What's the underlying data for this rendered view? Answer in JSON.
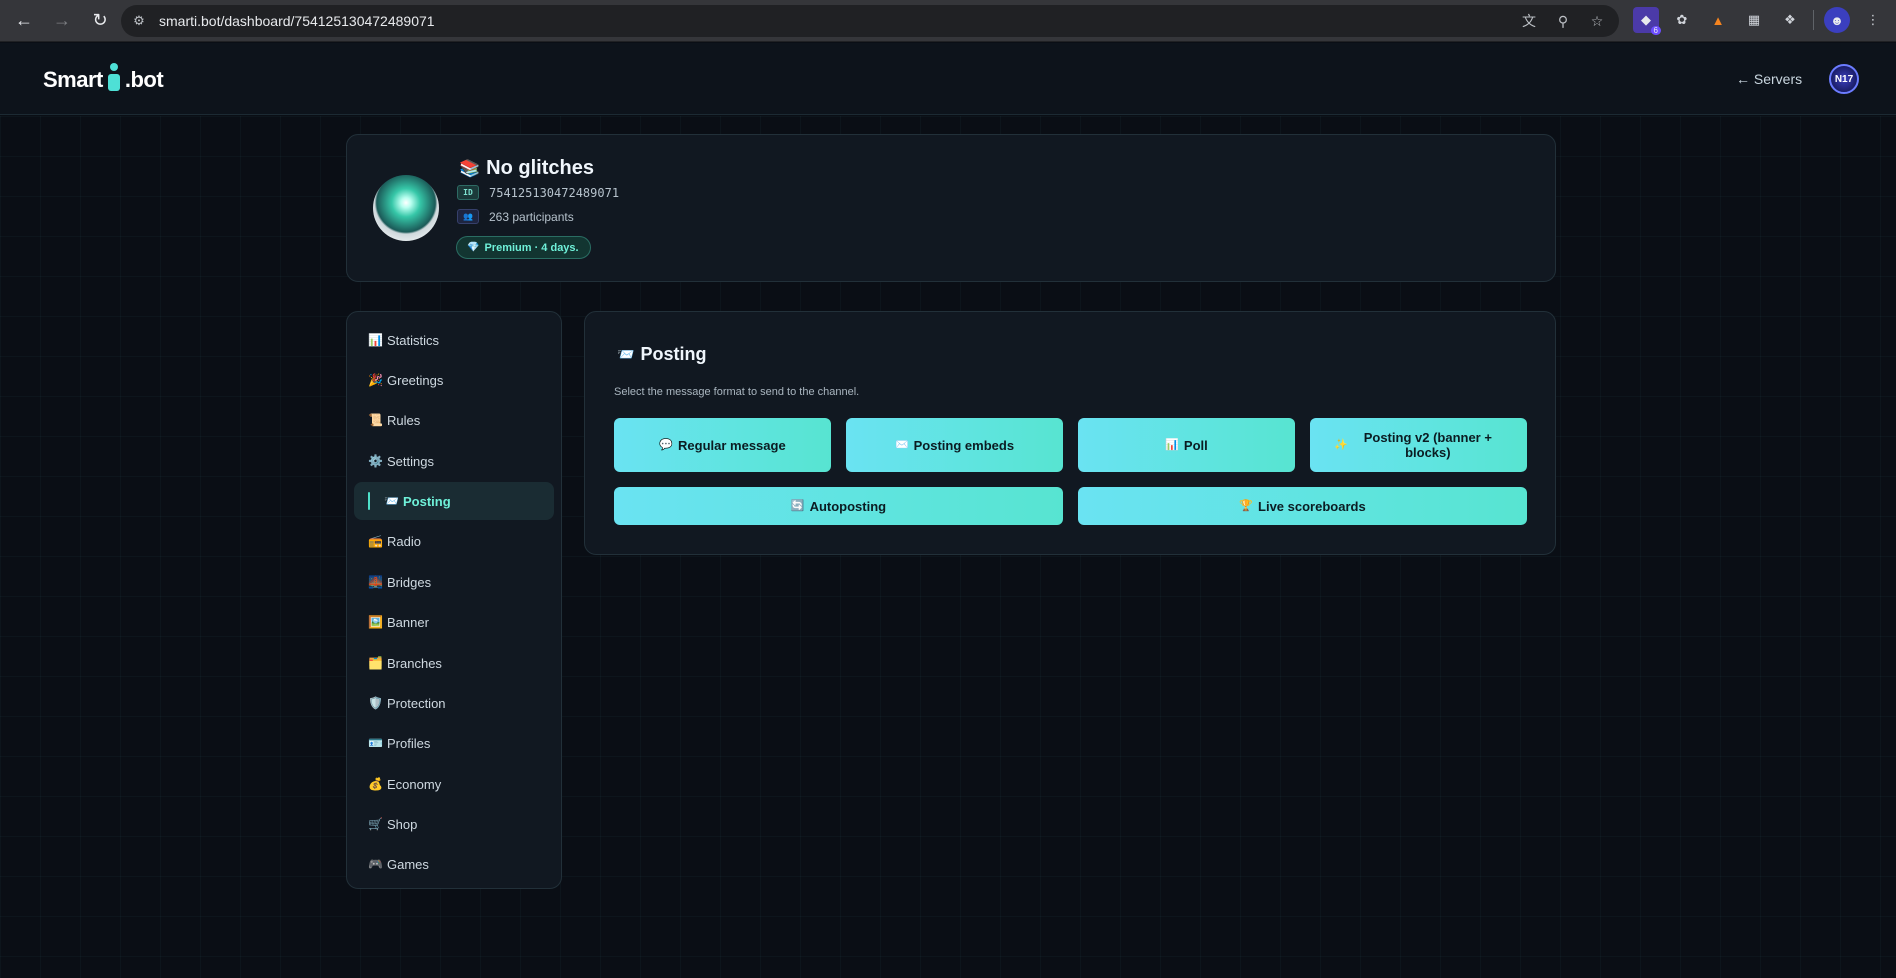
{
  "browser": {
    "url": "smarti.bot/dashboard/754125130472489071",
    "extension_badge": "6"
  },
  "header": {
    "logo_left": "Smart",
    "logo_right": ".bot",
    "back_link": "← Servers",
    "user_initials": "N17"
  },
  "server": {
    "name": "No glitches",
    "id_tag": "ID",
    "id": "754125130472489071",
    "participants_tag": "👥",
    "participants": "263 participants",
    "premium": "Premium · 4 days."
  },
  "sidebar": {
    "items": [
      {
        "icon": "📊",
        "label": "Statistics"
      },
      {
        "icon": "🎉",
        "label": "Greetings"
      },
      {
        "icon": "📜",
        "label": "Rules"
      },
      {
        "icon": "⚙️",
        "label": "Settings"
      },
      {
        "icon": "📨",
        "label": "Posting",
        "active": true
      },
      {
        "icon": "📻",
        "label": "Radio"
      },
      {
        "icon": "🌉",
        "label": "Bridges"
      },
      {
        "icon": "🖼️",
        "label": "Banner"
      },
      {
        "icon": "🗂️",
        "label": "Branches"
      },
      {
        "icon": "🛡️",
        "label": "Protection"
      },
      {
        "icon": "🪪",
        "label": "Profiles"
      },
      {
        "icon": "💰",
        "label": "Economy"
      },
      {
        "icon": "🛒",
        "label": "Shop"
      },
      {
        "icon": "🎮",
        "label": "Games"
      }
    ]
  },
  "main": {
    "title_icon": "📨",
    "title": "Posting",
    "description": "Select the message format to send to the channel.",
    "buttons": [
      {
        "icon": "💬",
        "label": "Regular message"
      },
      {
        "icon": "✉️",
        "label": "Posting embeds"
      },
      {
        "icon": "📊",
        "label": "Poll"
      },
      {
        "icon": "✨",
        "label": "Posting v2 (banner + blocks)"
      },
      {
        "icon": "🔄",
        "label": "Autoposting"
      },
      {
        "icon": "🏆",
        "label": "Live scoreboards"
      }
    ]
  }
}
